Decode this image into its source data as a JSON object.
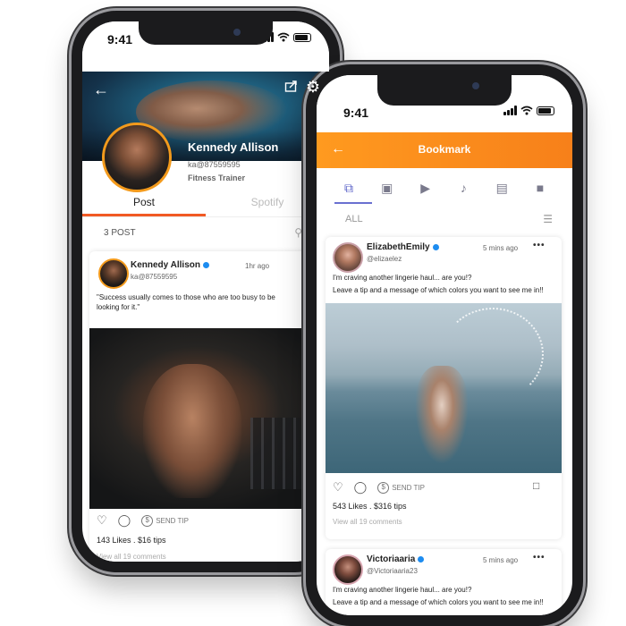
{
  "left_phone": {
    "time": "9:41",
    "profile": {
      "name": "Kennedy Allison",
      "handle": "ka@87559595",
      "role": "Fitness Trainer"
    },
    "tabs": [
      {
        "label": "Post",
        "active": true
      },
      {
        "label": "Spotify",
        "active": false
      }
    ],
    "post_count": "3 POST",
    "post": {
      "author": "Kennedy Allison",
      "handle": "ka@87559595",
      "time_ago": "1hr ago",
      "text_line1": "\"Success usually comes to those who are too busy to be",
      "text_line2": "looking for it.\"",
      "send_tip": "SEND TIP",
      "stats": "143 Likes . $16 tips",
      "view_all": "View all 19 comments"
    }
  },
  "right_phone": {
    "time": "9:41",
    "header_title": "Bookmark",
    "categories": [
      "posts-icon",
      "image-icon",
      "video-icon",
      "audio-icon",
      "text-icon",
      "lock-icon"
    ],
    "filter_label": "ALL",
    "posts": [
      {
        "author": "ElizabethEmily",
        "handle": "@elizaelez",
        "time_ago": "5 mins ago",
        "text_line1": "I'm craving another lingerie haul... are you!?",
        "text_line2": "Leave a tip and a message of which colors you want to see me in!!",
        "send_tip": "SEND TIP",
        "stats": "543 Likes . $316 tips",
        "view_all": "View all 19 comments"
      },
      {
        "author": "Victoriaaria",
        "handle": "@Victoriaaria23",
        "time_ago": "5 mins ago",
        "text_line1": "I'm craving another lingerie haul... are you!?",
        "text_line2": "Leave a tip and a message of which colors you want to see me in!!"
      }
    ]
  },
  "colors": {
    "accent_orange": "#f7801a",
    "tab_underline": "#f15a24",
    "verified_blue": "#1d8cf0",
    "category_active": "#5a62c8"
  }
}
